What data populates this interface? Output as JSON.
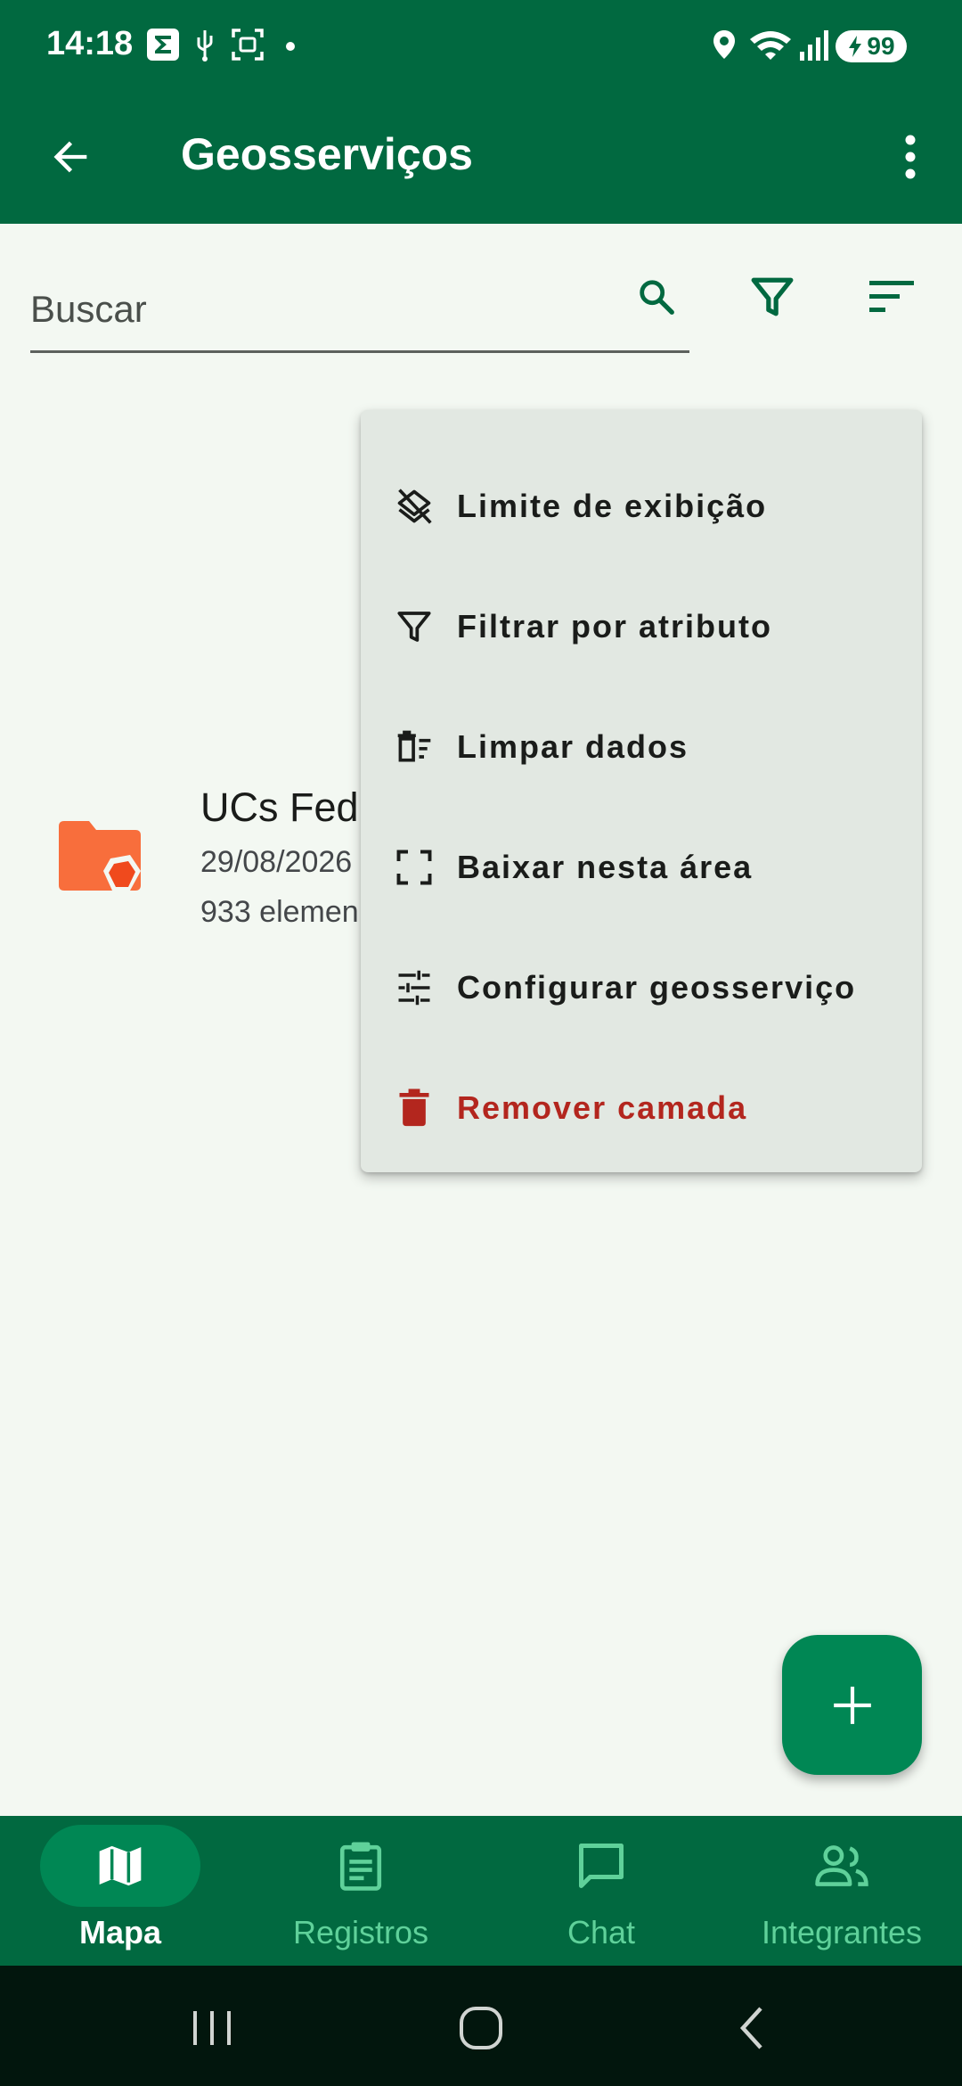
{
  "status_bar": {
    "time": "14:18",
    "battery": "99"
  },
  "app_bar": {
    "title": "Geosserviços"
  },
  "search": {
    "placeholder": "Buscar"
  },
  "list": {
    "items": [
      {
        "title": "UCs Fed",
        "date": "29/08/2026",
        "count": "933 elemen"
      }
    ]
  },
  "menu": {
    "items": [
      {
        "label": "Limite de exibição",
        "icon": "layers-off-icon"
      },
      {
        "label": "Filtrar por atributo",
        "icon": "filter-icon"
      },
      {
        "label": "Limpar dados",
        "icon": "delete-sweep-icon"
      },
      {
        "label": "Baixar nesta área",
        "icon": "crop-free-icon"
      },
      {
        "label": "Configurar geosserviço",
        "icon": "tune-icon"
      },
      {
        "label": "Remover camada",
        "icon": "trash-icon"
      }
    ]
  },
  "bottom_nav": {
    "items": [
      {
        "label": "Mapa",
        "icon": "map-icon",
        "active": true
      },
      {
        "label": "Registros",
        "icon": "clipboard-icon"
      },
      {
        "label": "Chat",
        "icon": "chat-icon"
      },
      {
        "label": "Integrantes",
        "icon": "people-icon"
      }
    ]
  },
  "colors": {
    "primary": "#016940",
    "fab": "#008754",
    "danger": "#b3261e",
    "folder": "#f86e3c"
  }
}
